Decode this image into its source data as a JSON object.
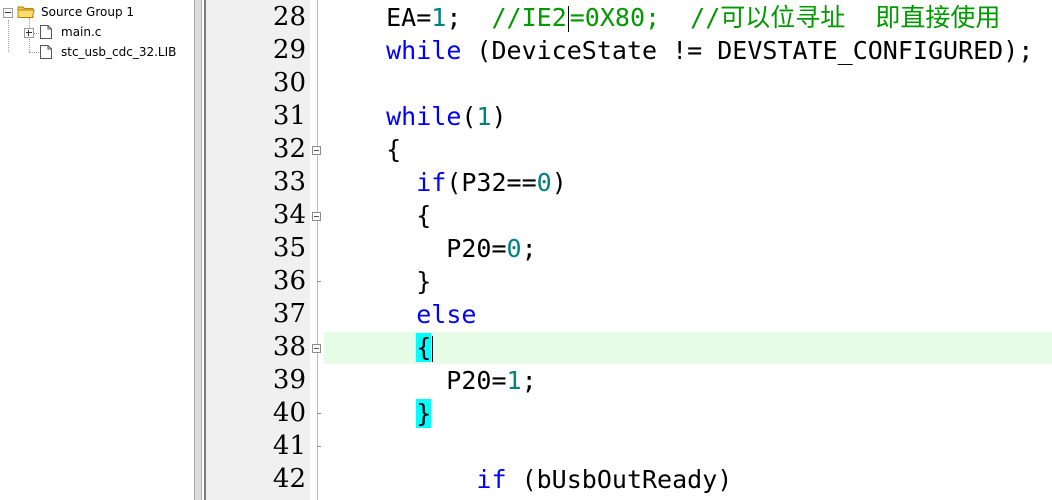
{
  "project_tree": {
    "group": "Source Group 1",
    "files": [
      {
        "name": "main.c",
        "expandable": true
      },
      {
        "name": "stc_usb_cdc_32.LIB",
        "expandable": false
      }
    ]
  },
  "editor": {
    "current_line": "38",
    "lines": [
      {
        "num": "28",
        "fold": false,
        "tokens": [
          {
            "t": "  EA=",
            "c": ""
          },
          {
            "t": "1",
            "c": "num"
          },
          {
            "t": ";  ",
            "c": ""
          },
          {
            "t": "//IE2",
            "c": "cm"
          },
          {
            "t": "|",
            "c": "caret"
          },
          {
            "t": "=0X80;  //可以位寻址  即直接使用",
            "c": "cm"
          }
        ]
      },
      {
        "num": "29",
        "fold": false,
        "tokens": [
          {
            "t": "  ",
            "c": ""
          },
          {
            "t": "while",
            "c": "kw"
          },
          {
            "t": " (DeviceState != DEVSTATE_CONFIGURED);",
            "c": ""
          }
        ]
      },
      {
        "num": "30",
        "fold": false,
        "tokens": []
      },
      {
        "num": "31",
        "fold": false,
        "tokens": [
          {
            "t": "  ",
            "c": ""
          },
          {
            "t": "while",
            "c": "kw"
          },
          {
            "t": "(",
            "c": ""
          },
          {
            "t": "1",
            "c": "num"
          },
          {
            "t": ")",
            "c": ""
          }
        ]
      },
      {
        "num": "32",
        "fold": true,
        "tokens": [
          {
            "t": "  {",
            "c": ""
          }
        ]
      },
      {
        "num": "33",
        "fold": false,
        "tokens": [
          {
            "t": "    ",
            "c": ""
          },
          {
            "t": "if",
            "c": "kw"
          },
          {
            "t": "(P32==",
            "c": ""
          },
          {
            "t": "0",
            "c": "num"
          },
          {
            "t": ")",
            "c": ""
          }
        ]
      },
      {
        "num": "34",
        "fold": true,
        "tokens": [
          {
            "t": "    {",
            "c": ""
          }
        ]
      },
      {
        "num": "35",
        "fold": false,
        "tokens": [
          {
            "t": "      P20=",
            "c": ""
          },
          {
            "t": "0",
            "c": "num"
          },
          {
            "t": ";",
            "c": ""
          }
        ]
      },
      {
        "num": "36",
        "fold": false,
        "tick": true,
        "tokens": [
          {
            "t": "    }",
            "c": ""
          }
        ]
      },
      {
        "num": "37",
        "fold": false,
        "tokens": [
          {
            "t": "    ",
            "c": ""
          },
          {
            "t": "else",
            "c": "kw"
          }
        ]
      },
      {
        "num": "38",
        "fold": true,
        "tokens": [
          {
            "t": "    ",
            "c": ""
          },
          {
            "t": "{",
            "c": "brace-hl"
          },
          {
            "t": "|",
            "c": "caret"
          }
        ]
      },
      {
        "num": "39",
        "fold": false,
        "tokens": [
          {
            "t": "      P20=",
            "c": ""
          },
          {
            "t": "1",
            "c": "num"
          },
          {
            "t": ";",
            "c": ""
          }
        ]
      },
      {
        "num": "40",
        "fold": false,
        "tick": true,
        "tokens": [
          {
            "t": "    ",
            "c": ""
          },
          {
            "t": "}",
            "c": "brace-hl"
          }
        ]
      },
      {
        "num": "41",
        "fold": false,
        "tick": true,
        "tokens": []
      },
      {
        "num": "42",
        "fold": false,
        "tokens": [
          {
            "t": "        ",
            "c": ""
          },
          {
            "t": "if",
            "c": "kw"
          },
          {
            "t": " (bUsbOutReady)",
            "c": ""
          }
        ]
      }
    ]
  },
  "colors": {
    "keyword": "#0000ff",
    "number": "#008080",
    "comment": "#009900",
    "current_line_bg": "#e6fce6",
    "brace_match_bg": "#00ffff",
    "gutter_bg": "#f0f0f0"
  },
  "icons": {
    "group": "folder-icon",
    "file": "document-icon",
    "expander": "tree-expander-icon",
    "fold": "fold-minus-icon"
  }
}
